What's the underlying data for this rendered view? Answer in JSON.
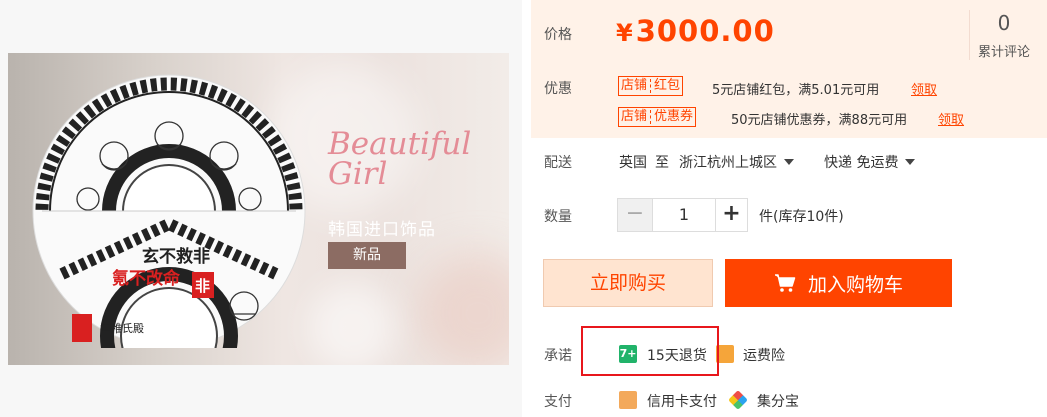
{
  "banner": {
    "script_line1": "Beautiful",
    "script_line2": "Girl",
    "tagline": "韩国进口饰品",
    "tag": "新品",
    "plate_text_top": "玄不救非",
    "plate_text_mid": "氪不改命",
    "plate_badge": "非",
    "plate_small": "童稚氏殿"
  },
  "price": {
    "label": "价格",
    "currency": "¥",
    "value": "3000.00",
    "review_count": "0",
    "review_label": "累计评论"
  },
  "promo": {
    "label": "优惠",
    "items": [
      {
        "badge_a": "店铺",
        "badge_b": "红包",
        "desc": "5元店铺红包，满5.01元可用",
        "action": "领取"
      },
      {
        "badge_a": "店铺",
        "badge_b": "优惠券",
        "desc": "50元店铺优惠券，满88元可用",
        "action": "领取"
      }
    ]
  },
  "delivery": {
    "label": "配送",
    "from": "英国",
    "to_word": "至",
    "destination": "浙江杭州上城区",
    "method": "快递 免运费"
  },
  "quantity": {
    "label": "数量",
    "minus": "−",
    "value": "1",
    "plus": "+",
    "stock": "件(库存10件)"
  },
  "actions": {
    "buy_now": "立即购买",
    "add_cart": "加入购物车"
  },
  "promise": {
    "label": "承诺",
    "items": [
      {
        "icon": "7-day-return-icon",
        "icon_text": "7+",
        "text": "15天退货"
      },
      {
        "icon": "shipping-insurance-icon",
        "text": "运费险"
      }
    ]
  },
  "payment": {
    "label": "支付",
    "items": [
      {
        "icon": "credit-card-icon",
        "text": "信用卡支付"
      },
      {
        "icon": "jifenbao-icon",
        "text": "集分宝"
      }
    ]
  },
  "colors": {
    "accent": "#ff4400",
    "price_bg": "#fff2e8",
    "highlight": "#e8171c"
  }
}
